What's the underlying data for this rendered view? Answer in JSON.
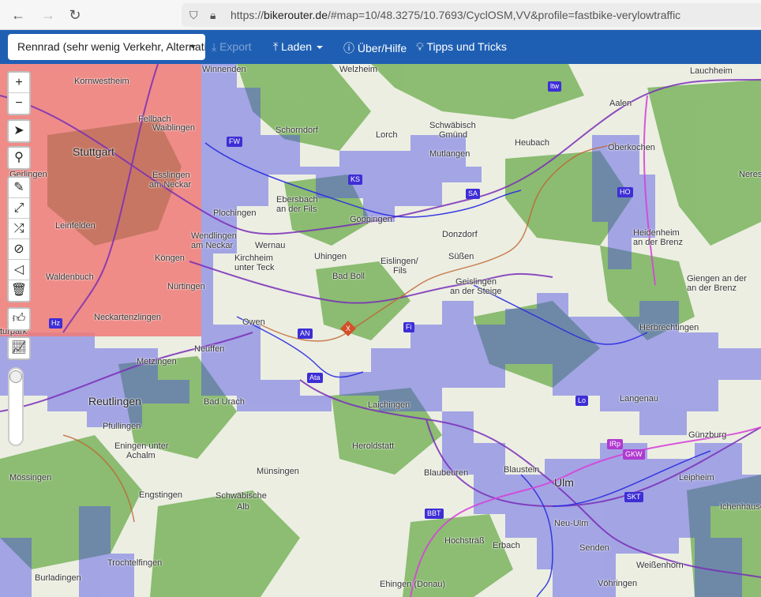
{
  "browser": {
    "url_prefix": "https://",
    "url_host": "bikerouter.de",
    "url_rest": "/#map=10/48.3275/10.7693/CyclOSM,VV&profile=fastbike-verylowtraffic"
  },
  "toolbar": {
    "profile": "Rennrad (sehr wenig Verkehr, Alternativ",
    "export": "Export",
    "load": "Laden",
    "help": "Über/Hilfe",
    "tips": "Tipps und Tricks"
  },
  "map_controls": {
    "zoom_in": "+",
    "zoom_out": "−"
  },
  "places": [
    {
      "name": "Kornwestheim",
      "big": false
    },
    {
      "name": "Winnenden",
      "big": false
    },
    {
      "name": "Welzheim",
      "big": false
    },
    {
      "name": "Lauchheim",
      "big": false
    },
    {
      "name": "Waiblingen",
      "big": false
    },
    {
      "name": "Aalen",
      "big": false
    },
    {
      "name": "Fellbach",
      "big": false
    },
    {
      "name": "Schorndorf",
      "big": false
    },
    {
      "name": "Schwäbisch",
      "big": false
    },
    {
      "name": "Gmünd",
      "big": false
    },
    {
      "name": "Stuttgart",
      "big": true
    },
    {
      "name": "Lorch",
      "big": false
    },
    {
      "name": "Heubach",
      "big": false
    },
    {
      "name": "Oberkochen",
      "big": false
    },
    {
      "name": "Mutlangen",
      "big": false
    },
    {
      "name": "Esslingen",
      "big": false
    },
    {
      "name": "am Neckar",
      "big": false
    },
    {
      "name": "Gerlingen",
      "big": false
    },
    {
      "name": "Ebersbach",
      "big": false
    },
    {
      "name": "an der Fils",
      "big": false
    },
    {
      "name": "Neres",
      "big": false
    },
    {
      "name": "Plochingen",
      "big": false
    },
    {
      "name": "Göppingen",
      "big": false
    },
    {
      "name": "Leinfelden",
      "big": false
    },
    {
      "name": "Donzdorf",
      "big": false
    },
    {
      "name": "Heidenheim",
      "big": false
    },
    {
      "name": "an der Brenz",
      "big": false
    },
    {
      "name": "Wendlingen",
      "big": false
    },
    {
      "name": "am Neckar",
      "big": false
    },
    {
      "name": "Wernau",
      "big": false
    },
    {
      "name": "Kirchheim",
      "big": false
    },
    {
      "name": "unter Teck",
      "big": false
    },
    {
      "name": "Uhingen",
      "big": false
    },
    {
      "name": "Eislingen/",
      "big": false
    },
    {
      "name": "Fils",
      "big": false
    },
    {
      "name": "Süßen",
      "big": false
    },
    {
      "name": "Köngen",
      "big": false
    },
    {
      "name": "Waldenbuch",
      "big": false
    },
    {
      "name": "Bad Boll",
      "big": false
    },
    {
      "name": "Geislingen",
      "big": false
    },
    {
      "name": "an der Steige",
      "big": false
    },
    {
      "name": "Giengen an der",
      "big": false
    },
    {
      "name": "an der Brenz",
      "big": false
    },
    {
      "name": "Nürtingen",
      "big": false
    },
    {
      "name": "Neckartenzlingen",
      "big": false
    },
    {
      "name": "Owen",
      "big": false
    },
    {
      "name": "Herbrechtingen",
      "big": false
    },
    {
      "name": "Neuffen",
      "big": false
    },
    {
      "name": "Metzingen",
      "big": false
    },
    {
      "name": "Reutlingen",
      "big": true
    },
    {
      "name": "Bad Urach",
      "big": false
    },
    {
      "name": "Laichingen",
      "big": false
    },
    {
      "name": "Langenau",
      "big": false
    },
    {
      "name": "Pfullingen",
      "big": false
    },
    {
      "name": "Eningen unter",
      "big": false
    },
    {
      "name": "Achalm",
      "big": false
    },
    {
      "name": "Heroldstatt",
      "big": false
    },
    {
      "name": "Günzburg",
      "big": false
    },
    {
      "name": "Mössingen",
      "big": false
    },
    {
      "name": "Münsingen",
      "big": false
    },
    {
      "name": "Blaubeuren",
      "big": false
    },
    {
      "name": "Blaustein",
      "big": false
    },
    {
      "name": "Ulm",
      "big": true
    },
    {
      "name": "Leipheim",
      "big": false
    },
    {
      "name": "Engstingen",
      "big": false
    },
    {
      "name": "Schwäbische",
      "big": false
    },
    {
      "name": "Alb",
      "big": false
    },
    {
      "name": "Ichenhause",
      "big": false
    },
    {
      "name": "Neu-Ulm",
      "big": false
    },
    {
      "name": "Hochsträß",
      "big": false
    },
    {
      "name": "Erbach",
      "big": false
    },
    {
      "name": "Senden",
      "big": false
    },
    {
      "name": "Trochtelfingen",
      "big": false
    },
    {
      "name": "Weißenhorn",
      "big": false
    },
    {
      "name": "Burladingen",
      "big": false
    },
    {
      "name": "Ehingen (Donau)",
      "big": false
    },
    {
      "name": "Vöhringen",
      "big": false
    },
    {
      "name": "turpark",
      "big": false
    }
  ],
  "badges": [
    {
      "text": "ltw",
      "pink": false
    },
    {
      "text": "FW",
      "pink": false
    },
    {
      "text": "KS",
      "pink": false
    },
    {
      "text": "SA",
      "pink": false
    },
    {
      "text": "HO",
      "pink": false
    },
    {
      "text": "Hz",
      "pink": false
    },
    {
      "text": "AN",
      "pink": false
    },
    {
      "text": "Fi",
      "pink": false
    },
    {
      "text": "Ata",
      "pink": false
    },
    {
      "text": "Lo",
      "pink": false
    },
    {
      "text": "IRp",
      "pink": true
    },
    {
      "text": "GKW",
      "pink": true
    },
    {
      "text": "SKT",
      "pink": false
    },
    {
      "text": "BBT",
      "pink": false
    }
  ],
  "route_marker": "X",
  "colors": {
    "toolbar": "#1f5fb3",
    "no_route_area": "#f07a78",
    "low_traffic_overlay": "#4b4be8",
    "forest": "#7bb45e"
  }
}
